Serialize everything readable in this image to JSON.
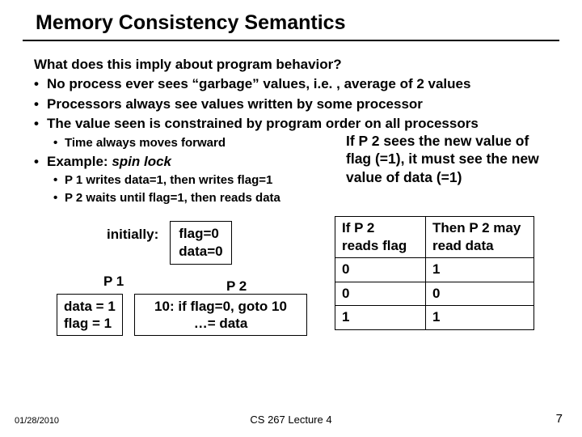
{
  "title": "Memory Consistency Semantics",
  "question": "What does this imply about program behavior?",
  "bullets": [
    "No process ever sees “garbage” values, i.e. , average of 2 values",
    "Processors always see values written by some processor",
    "The value seen is constrained by program order on all processors"
  ],
  "sub_time": "Time always moves forward",
  "example_label": "Example: ",
  "example_em": "spin lock",
  "sub_p1": "P 1 writes data=1, then writes flag=1",
  "sub_p2": "P 2 waits until flag=1, then reads data",
  "callout": "If P 2 sees the new value of flag (=1), it must see the new value of data (=1)",
  "init_label": "initially:",
  "init_flag": "flag=0",
  "init_data": "data=0",
  "p1_label": "P 1",
  "p2_label": "P 2",
  "p1_box_l1": "data = 1",
  "p1_box_l2": "flag = 1",
  "p2_box_l1": "10: if flag=0, goto 10",
  "p2_box_l2": "…= data",
  "table": {
    "h1a": "If P 2",
    "h1b": "reads flag",
    "h2a": "Then P 2 may",
    "h2b": "read data",
    "rows": [
      [
        "0",
        "1"
      ],
      [
        "0",
        "0"
      ],
      [
        "1",
        "1"
      ]
    ]
  },
  "footer": {
    "date": "01/28/2010",
    "center": "CS 267 Lecture 4",
    "page": "7"
  }
}
